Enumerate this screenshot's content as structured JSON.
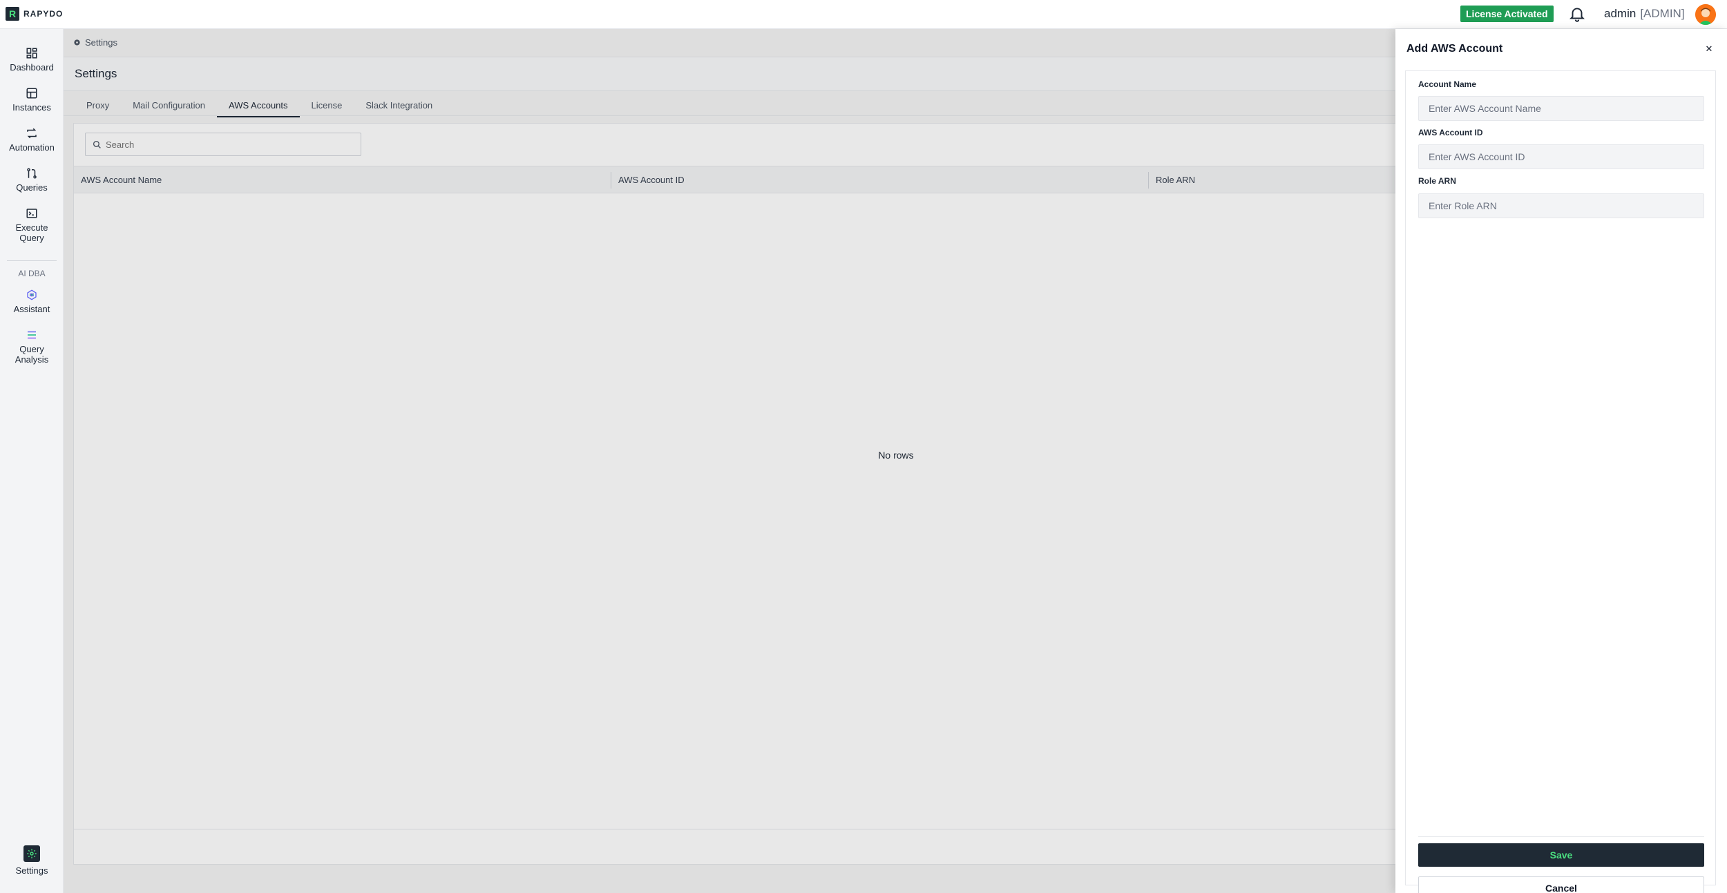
{
  "topbar": {
    "logo_letter": "R",
    "logo_text": "RAPYDO",
    "license_badge": "License Activated",
    "user_name": "admin",
    "user_role": "[ADMIN]"
  },
  "sidebar": {
    "items": [
      {
        "label": "Dashboard",
        "icon": "dashboard-icon"
      },
      {
        "label": "Instances",
        "icon": "instances-icon"
      },
      {
        "label": "Automation",
        "icon": "automation-icon"
      },
      {
        "label": "Queries",
        "icon": "queries-icon"
      },
      {
        "label": "Execute",
        "label2": "Query",
        "icon": "terminal-icon"
      }
    ],
    "section_label": "AI DBA",
    "ai_items": [
      {
        "label": "Assistant",
        "icon": "assistant-icon"
      },
      {
        "label": "Query",
        "label2": "Analysis",
        "icon": "query-analysis-icon"
      }
    ],
    "settings_label": "Settings"
  },
  "main": {
    "breadcrumb": "Settings",
    "page_title": "Settings",
    "tabs": [
      {
        "label": "Proxy"
      },
      {
        "label": "Mail Configuration"
      },
      {
        "label": "AWS Accounts",
        "active": true
      },
      {
        "label": "License"
      },
      {
        "label": "Slack Integration"
      }
    ],
    "search_placeholder": "Search",
    "columns": [
      "AWS Account Name",
      "AWS Account ID",
      "Role ARN"
    ],
    "empty_text": "No rows"
  },
  "drawer": {
    "title": "Add AWS Account",
    "fields": [
      {
        "label": "Account Name",
        "placeholder": "Enter AWS Account Name",
        "value": ""
      },
      {
        "label": "AWS Account ID",
        "placeholder": "Enter AWS Account ID",
        "value": ""
      },
      {
        "label": "Role ARN",
        "placeholder": "Enter Role ARN",
        "value": ""
      }
    ],
    "save_label": "Save",
    "cancel_label": "Cancel"
  },
  "colors": {
    "brand_dark": "#1f2a35",
    "brand_green": "#4ade80",
    "license_green": "#1f9d55"
  }
}
